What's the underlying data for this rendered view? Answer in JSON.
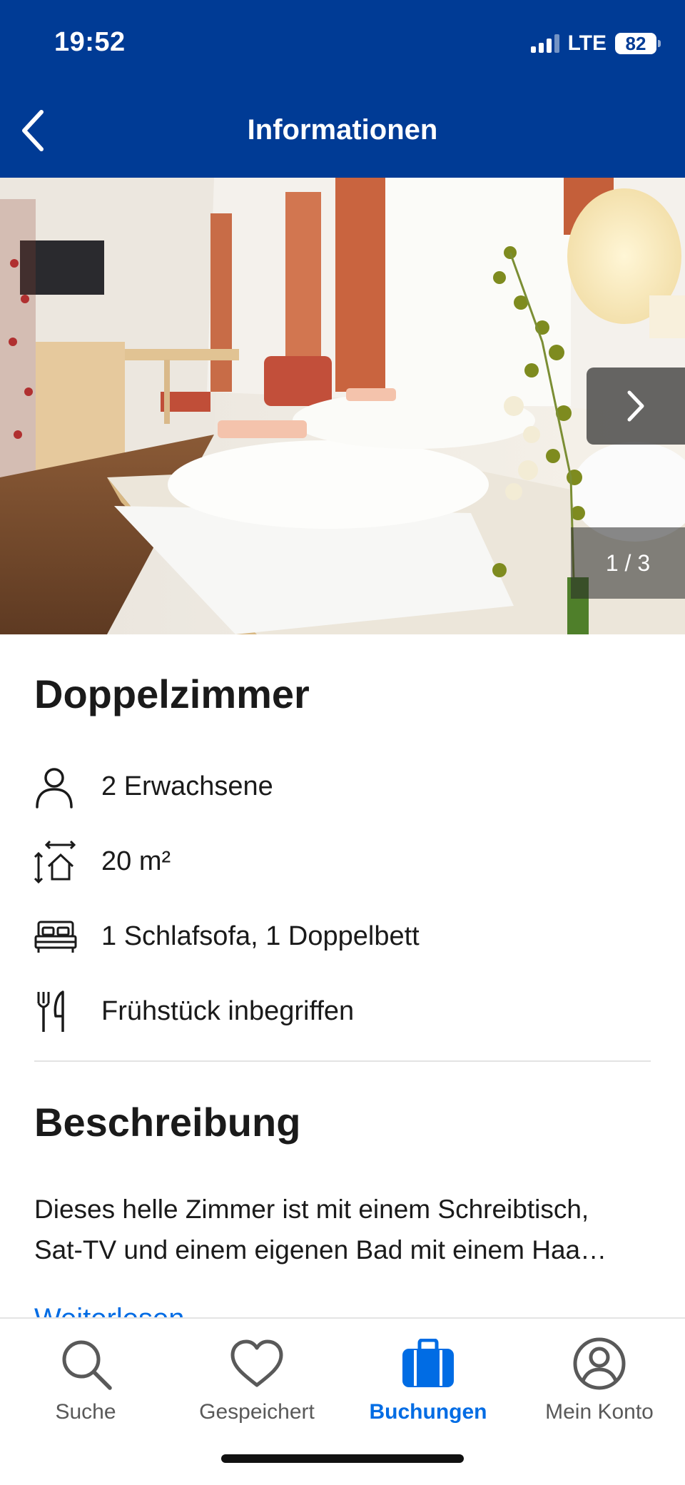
{
  "status_bar": {
    "time": "19:52",
    "network": "LTE",
    "battery": "82"
  },
  "header": {
    "title": "Informationen",
    "back_icon": "chevron-left-icon"
  },
  "gallery": {
    "counter": "1 / 3",
    "next_icon": "chevron-right-icon"
  },
  "room": {
    "title": "Doppelzimmer",
    "facts": [
      {
        "icon": "person-icon",
        "text": "2 Erwachsene"
      },
      {
        "icon": "room-size-icon",
        "text": "20 m²"
      },
      {
        "icon": "bed-icon",
        "text": "1 Schlafsofa, 1 Doppelbett"
      },
      {
        "icon": "cutlery-icon",
        "text": "Frühstück inbegriffen"
      }
    ]
  },
  "description": {
    "heading": "Beschreibung",
    "line1": "Dieses helle Zimmer ist mit einem Schreibtisch,",
    "line2": "Sat-TV und einem eigenen Bad mit einem Haa…",
    "read_more": "Weiterlesen"
  },
  "tabbar": {
    "items": [
      {
        "label": "Suche",
        "icon": "search-icon"
      },
      {
        "label": "Gespeichert",
        "icon": "heart-icon"
      },
      {
        "label": "Buchungen",
        "icon": "suitcase-icon"
      },
      {
        "label": "Mein Konto",
        "icon": "account-icon"
      }
    ],
    "active_color": "#006ce4"
  },
  "colors": {
    "brand": "#003b95",
    "link": "#006ce4"
  }
}
